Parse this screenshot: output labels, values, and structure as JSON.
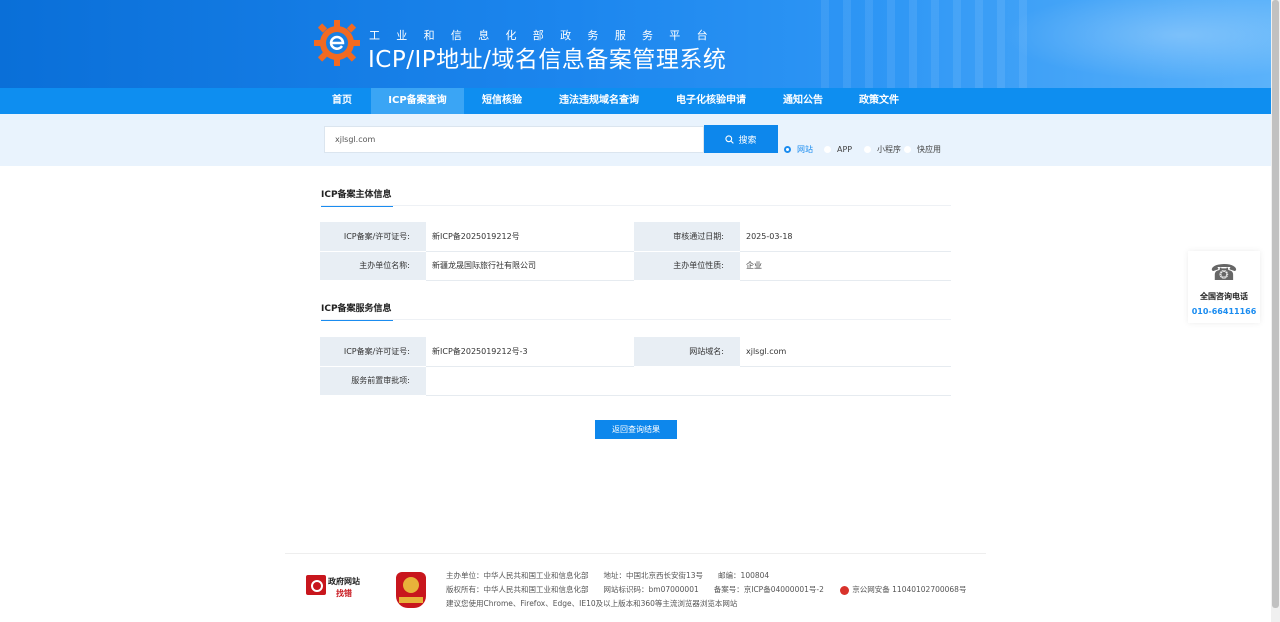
{
  "header": {
    "subtitle": "工业和信息化部政务服务平台",
    "title": "ICP/IP地址/域名信息备案管理系统"
  },
  "nav": {
    "items": [
      "首页",
      "ICP备案查询",
      "短信核验",
      "违法违规域名查询",
      "电子化核验申请",
      "通知公告",
      "政策文件"
    ],
    "active": "ICP备案查询"
  },
  "search": {
    "value": "xjlsgl.com",
    "button_label": "搜索",
    "types": [
      "网站",
      "APP",
      "小程序",
      "快应用"
    ],
    "selected_type": "网站"
  },
  "subject_info": {
    "title": "ICP备案主体信息",
    "license_label": "ICP备案/许可证号:",
    "license_value": "新ICP备2025019212号",
    "approve_date_label": "审核通过日期:",
    "approve_date_value": "2025-03-18",
    "org_name_label": "主办单位名称:",
    "org_name_value": "新疆龙晟国际旅行社有限公司",
    "org_type_label": "主办单位性质:",
    "org_type_value": "企业"
  },
  "service_info": {
    "title": "ICP备案服务信息",
    "license_label": "ICP备案/许可证号:",
    "license_value": "新ICP备2025019212号-3",
    "domain_label": "网站域名:",
    "domain_value": "xjlsgl.com",
    "preapproval_label": "服务前置审批项:",
    "preapproval_value": ""
  },
  "back_button": "返回查询结果",
  "side_contact": {
    "icon": "phone-icon",
    "label": "全国咨询电话",
    "phone": "010-66411166"
  },
  "footer": {
    "findbad_line1": "政府网站",
    "findbad_line2": "找错",
    "line1": "主办单位：中华人民共和国工业和信息化部　　地址：中国北京西长安街13号　　邮编：100804",
    "line2_a": "版权所有：中华人民共和国工业和信息化部　　网站标识码：bm07000001　　备案号：京ICP备04000001号-2",
    "line2_b": "京公网安备 11040102700068号",
    "line3": "建议您使用Chrome、Firefox、Edge、IE10及以上版本和360等主流浏览器浏览本网站"
  },
  "colors": {
    "primary": "#0d87ec",
    "nav_bg": "#0e8ef0",
    "nav_active": "#3aa5f5",
    "search_band": "#e9f3fd",
    "label_bg": "#e8eef4"
  }
}
